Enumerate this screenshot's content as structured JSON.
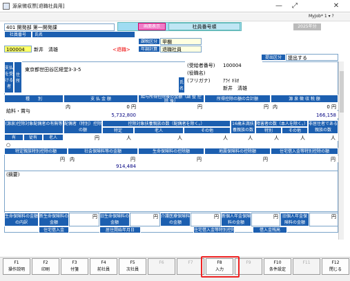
{
  "window": {
    "title": "源泉徴収票[退職社員用]"
  },
  "toolbar": {
    "myjob": "MyJob*",
    "num": "1"
  },
  "employee": {
    "dept": "401 開発部 第一開発課",
    "number_label": "社員番号",
    "name_label": "氏名",
    "number": "100004",
    "name": "新井　清雄",
    "status": "<退職>",
    "tax_label": "課税区分",
    "tax_value": "甲欄",
    "year_label": "年調計算",
    "year_value": "退職社員"
  },
  "header": {
    "mode": "画面表示",
    "sort": "社員番号順",
    "year": "2025年分"
  },
  "submission": {
    "label": "提出区分",
    "value": "提出する"
  },
  "payee": {
    "side_label": "支払を受ける者",
    "addr_label": "住所",
    "address": "東京都世田谷区経堂3-3-5",
    "rec_no_label": "(受給者番号)",
    "rec_no": "100004",
    "role_label": "(役職名)",
    "furi_label": "(フリガナ)",
    "furi": "ｱﾗｲ ｷﾖｵ",
    "name_label": "氏名",
    "name": "新井　清雄"
  },
  "income": {
    "col_type": "種　　別",
    "col_pay": "支 払 金 額",
    "col_deduct": "給与所得控除後の金額（調 整 控 除 後）",
    "col_total": "所得控除の額の合計額",
    "col_tax": "源 泉 徴 収 税 額",
    "type": "給料・賞与",
    "inner": "内",
    "yen": "円",
    "pay_zero": "0 円",
    "pay": "5,732,800",
    "tax_zero": "0 円",
    "tax": "166,158"
  },
  "deps": {
    "spouse_label": "(源泉)控除対象配偶者の有無等",
    "spouse_amt": "配偶者（特別）控除の額",
    "dep_count": "控除対象扶養親族の数（配偶者を除く。）",
    "special": "特定",
    "elderly": "老人",
    "other": "その他",
    "under16": "16歳未満扶養親族の数",
    "disabled": "障害者の数（本人を除く。）",
    "nonres": "非居住者である親族の数",
    "yes": "有",
    "subordinate": "従有",
    "elder": "老人",
    "person": "人",
    "inner": "内",
    "sp": "特別",
    "ot": "その他",
    "mark": "○"
  },
  "insurance": {
    "special_label": "特定親族特別控除の額",
    "social": "社会保険料等の金額",
    "life": "生命保険料の控除額",
    "quake": "地震保険料の控除額",
    "house": "住宅借入金等特別控除の額",
    "social_amt": "914,484",
    "yen": "円",
    "inner": "内"
  },
  "remarks": {
    "label": "(摘要)"
  },
  "bottom": {
    "life_breakdown": "生命保険料の金額の内訳",
    "new_life": "新生命保険料の金額",
    "old_life": "旧生命保険料の金額",
    "care": "介護医療保険料の金額",
    "new_pension": "新個人年金保険料の金額",
    "old_pension": "旧個人年金保険料の金額",
    "house_loan": "住宅借入金",
    "start_date": "居住開始年月日",
    "loan_cat": "住宅借入金等特別控除区分",
    "loan_bal": "借入金残高",
    "yen": "円"
  },
  "fkeys": [
    {
      "key": "F1",
      "label": "操作説明",
      "enabled": true
    },
    {
      "key": "F2",
      "label": "印刷",
      "enabled": true
    },
    {
      "key": "F3",
      "label": "付箋",
      "enabled": true
    },
    {
      "key": "F4",
      "label": "前社員",
      "enabled": true
    },
    {
      "key": "F5",
      "label": "次社員",
      "enabled": true
    },
    {
      "key": "F6",
      "label": "",
      "enabled": false
    },
    {
      "key": "F7",
      "label": "",
      "enabled": false
    },
    {
      "key": "F8",
      "label": "入力",
      "enabled": true
    },
    {
      "key": "F9",
      "label": "",
      "enabled": false
    },
    {
      "key": "F10",
      "label": "条件設定",
      "enabled": true
    },
    {
      "key": "F11",
      "label": "",
      "enabled": false
    },
    {
      "key": "F12",
      "label": "閉じる",
      "enabled": true
    }
  ]
}
